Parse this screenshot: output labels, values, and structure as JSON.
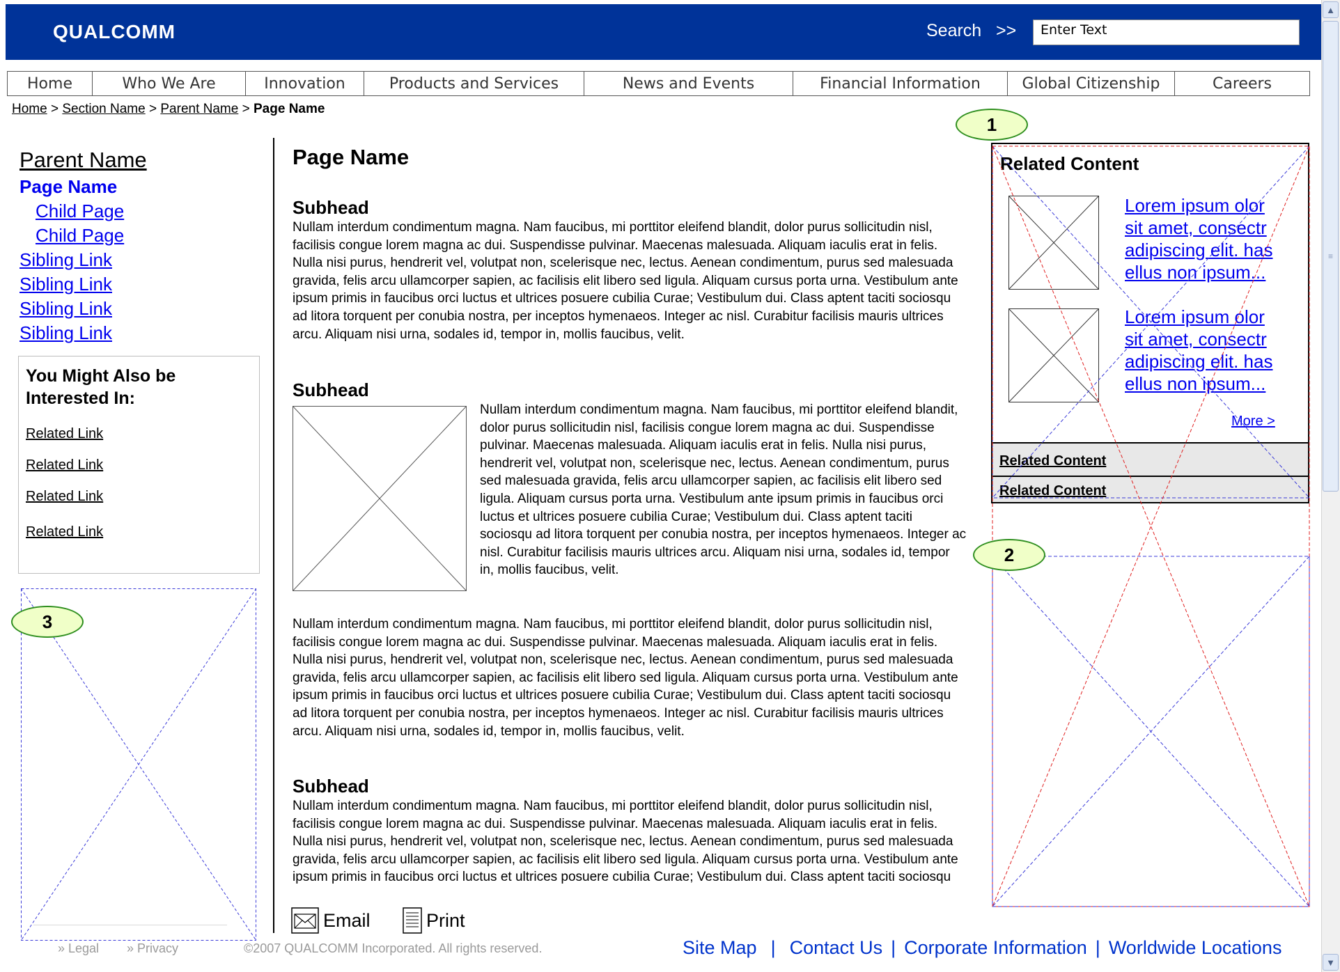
{
  "header": {
    "logo_text": "QUALCOMM",
    "search_label": "Search",
    "search_arrow": ">>",
    "search_placeholder": "Enter Text",
    "bg_color": "#003399"
  },
  "nav": {
    "tabs": [
      {
        "label": "Home"
      },
      {
        "label": "Who We Are"
      },
      {
        "label": "Innovation"
      },
      {
        "label": "Products and Services"
      },
      {
        "label": "News and Events"
      },
      {
        "label": "Financial Information"
      },
      {
        "label": "Global Citizenship"
      },
      {
        "label": "Careers"
      }
    ]
  },
  "breadcrumb": {
    "items": [
      "Home",
      "Section Name",
      "Parent Name"
    ],
    "separator": ">",
    "current": "Page Name"
  },
  "left_nav": {
    "parent": "Parent Name",
    "current": "Page Name",
    "children": [
      "Child Page",
      "Child Page"
    ],
    "siblings": [
      "Sibling Link",
      "Sibling Link",
      "Sibling Link",
      "Sibling Link"
    ]
  },
  "might_also": {
    "title": "You Might Also be Interested In:",
    "links": [
      "Related Link",
      "Related Link",
      "Related Link",
      "Related Link"
    ]
  },
  "main": {
    "title": "Page Name",
    "sections": [
      {
        "subhead": "Subhead",
        "text": "Nullam interdum condimentum magna. Nam faucibus, mi porttitor eleifend blandit, dolor purus sollicitudin nisl, facilisis congue lorem magna ac dui. Suspendisse pulvinar. Maecenas malesuada. Aliquam iaculis erat in felis. Nulla nisi purus, hendrerit vel, volutpat non, scelerisque nec, lectus. Aenean condimentum, purus sed malesuada gravida, felis arcu ullamcorper sapien, ac facilisis elit libero sed ligula. Aliquam cursus porta urna. Vestibulum ante ipsum primis in faucibus orci luctus et ultrices posuere cubilia Curae; Vestibulum dui. Class aptent taciti sociosqu ad litora torquent per conubia nostra, per inceptos hymenaeos. Integer ac nisl. Curabitur facilisis mauris ultrices arcu. Aliquam nisi urna, sodales id, tempor in, mollis faucibus, velit."
      },
      {
        "subhead": "Subhead",
        "text": "Nullam interdum condimentum magna. Nam faucibus, mi porttitor eleifend blandit, dolor purus sollicitudin nisl, facilisis congue lorem magna ac dui. Suspendisse pulvinar. Maecenas malesuada. Aliquam iaculis erat in felis. Nulla nisi purus, hendrerit vel, volutpat non, scelerisque nec, lectus. Aenean condimentum, purus sed malesuada gravida, felis arcu ullamcorper sapien, ac facilisis elit libero sed ligula. Aliquam cursus porta urna. Vestibulum ante ipsum primis in faucibus orci luctus et ultrices posuere cubilia Curae; Vestibulum dui. Class aptent taciti sociosqu ad litora torquent per conubia nostra, per inceptos hymenaeos. Integer ac nisl. Curabitur facilisis mauris ultrices arcu. Aliquam nisi urna, sodales id, tempor in, mollis faucibus, velit."
      },
      {
        "subhead": "",
        "text": "Nullam interdum condimentum magna. Nam faucibus, mi porttitor eleifend blandit, dolor purus sollicitudin nisl, facilisis congue lorem magna ac dui. Suspendisse pulvinar. Maecenas malesuada. Aliquam iaculis erat in felis. Nulla nisi purus, hendrerit vel, volutpat non, scelerisque nec, lectus. Aenean condimentum, purus sed malesuada gravida, felis arcu ullamcorper sapien, ac facilisis elit libero sed ligula. Aliquam cursus porta urna. Vestibulum ante ipsum primis in faucibus orci luctus et ultrices posuere cubilia Curae; Vestibulum dui. Class aptent taciti sociosqu ad litora torquent per conubia nostra, per inceptos hymenaeos. Integer ac nisl. Curabitur facilisis mauris ultrices arcu. Aliquam nisi urna, sodales id, tempor in, mollis faucibus, velit."
      },
      {
        "subhead": "Subhead",
        "text": "Nullam interdum condimentum magna. Nam faucibus, mi porttitor eleifend blandit, dolor purus sollicitudin nisl, facilisis congue lorem magna ac dui. Suspendisse pulvinar. Maecenas malesuada. Aliquam iaculis erat in felis. Nulla nisi purus, hendrerit vel, volutpat non, scelerisque nec, lectus. Aenean condimentum, purus sed malesuada gravida, felis arcu ullamcorper sapien, ac facilisis elit libero sed ligula. Aliquam cursus porta urna. Vestibulum ante ipsum primis in faucibus orci luctus et ultrices posuere cubilia Curae; Vestibulum dui. Class aptent taciti sociosqu"
      }
    ],
    "email_label": "Email",
    "print_label": "Print"
  },
  "related": {
    "title": "Related Content",
    "items": [
      {
        "text": "Lorem ipsum olor sit amet, consectr adipiscing elit. has ellus non ipsum..."
      },
      {
        "text": "Lorem ipsum olor sit amet, consectr adipiscing elit. has ellus non ipsum..."
      }
    ],
    "more": "More >",
    "bars": [
      "Related Content",
      "Related Content"
    ]
  },
  "callouts": [
    "1",
    "2",
    "3"
  ],
  "footer": {
    "legal": "» Legal",
    "privacy": "» Privacy",
    "copyright": "©2007 QUALCOMM Incorporated. All rights reserved.",
    "links": [
      "Site Map",
      "Contact Us",
      "Corporate Information",
      "Worldwide Locations"
    ],
    "separator": "|"
  }
}
